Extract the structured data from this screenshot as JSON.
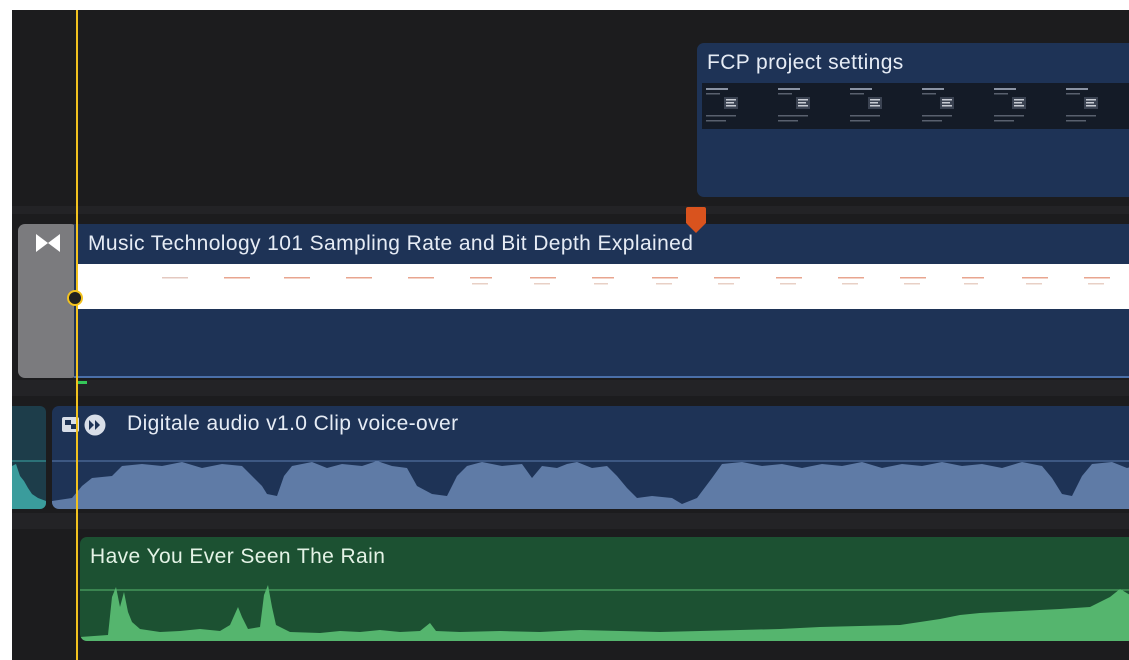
{
  "clips": {
    "fcp": {
      "title": "FCP project settings",
      "color": "#1e3356"
    },
    "music": {
      "title": "Music Technology 101 Sampling Rate and Bit Depth Explained",
      "color": "#1e3356"
    },
    "voiceover": {
      "title": "Digitale audio v1.0 Clip voice-over",
      "color": "#1e3356",
      "waveform_color": "#5f7ba6"
    },
    "song": {
      "title": "Have You Ever Seen The Rain",
      "color": "#1c5132",
      "waveform_color": "#55b56e"
    }
  },
  "colors": {
    "playhead": "#f2c21f",
    "marker": "#d9531e",
    "background": "#1c1c1e"
  },
  "icons": {
    "transition": "bowtie-transition-icon",
    "clip_connect": "connected-clip-icon",
    "retime": "retime-icon",
    "marker": "marker-icon"
  }
}
